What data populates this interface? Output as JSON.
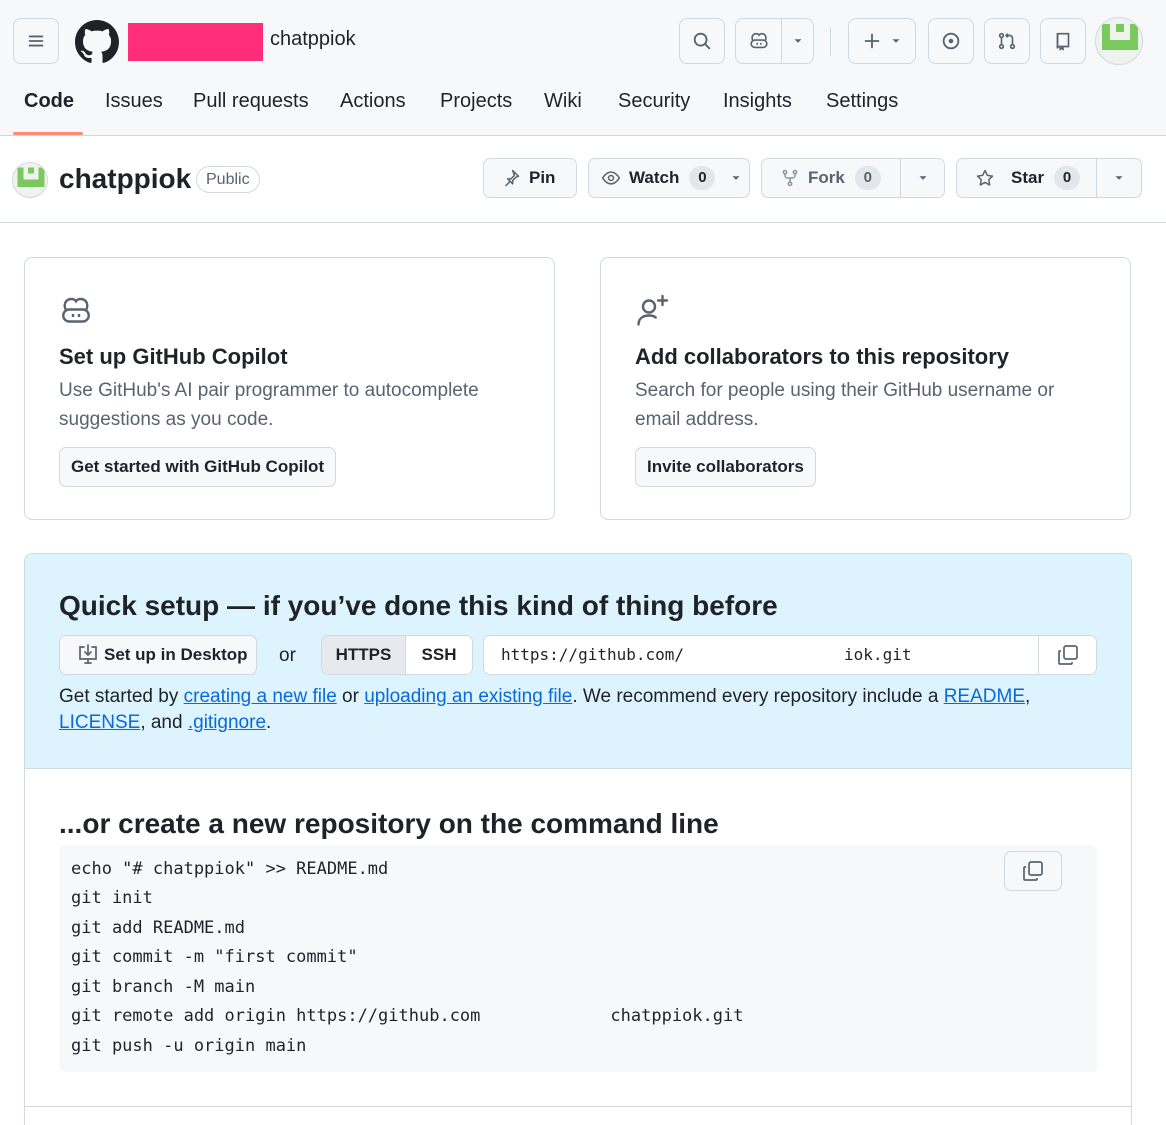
{
  "header": {
    "repo_name": "chatppiok",
    "owner_redact_color": "#ff2d7a",
    "icons": [
      "menu-icon",
      "github-logo",
      "search-icon",
      "copilot-icon",
      "chevron-down-icon",
      "plus-icon",
      "issues-icon",
      "pull-request-icon",
      "inbox-icon"
    ]
  },
  "nav": {
    "tabs": [
      {
        "label": "Code",
        "active": true
      },
      {
        "label": "Issues"
      },
      {
        "label": "Pull requests"
      },
      {
        "label": "Actions"
      },
      {
        "label": "Projects"
      },
      {
        "label": "Wiki"
      },
      {
        "label": "Security"
      },
      {
        "label": "Insights"
      },
      {
        "label": "Settings"
      }
    ],
    "active_underline_color": "#fd8c73"
  },
  "repo": {
    "title": "chatppiok",
    "visibility": "Public",
    "pin_label": "Pin",
    "watch_label": "Watch",
    "watch_count": "0",
    "fork_label": "Fork",
    "fork_count": "0",
    "star_label": "Star",
    "star_count": "0"
  },
  "cards": {
    "copilot": {
      "title": "Set up GitHub Copilot",
      "description": "Use GitHub's AI pair programmer to autocomplete suggestions as you code.",
      "button": "Get started with GitHub Copilot"
    },
    "collaborators": {
      "title": "Add collaborators to this repository",
      "description": "Search for people using their GitHub username or email address.",
      "button": "Invite collaborators"
    }
  },
  "quick_setup": {
    "title": "Quick setup — if you’ve done this kind of thing before",
    "desktop_button": "Set up in Desktop",
    "or": "or",
    "https_tab": "HTTPS",
    "ssh_tab": "SSH",
    "url_prefix": "https://github.com/",
    "url_suffix": "iok.git",
    "help": {
      "t1": "Get started by ",
      "link1": "creating a new file",
      "t2": " or ",
      "link2": "uploading an existing file",
      "t3": ". We recommend every repository include a ",
      "link3": "README",
      "t4": ", ",
      "link4": "LICENSE",
      "t5": ", and ",
      "link5": ".gitignore",
      "t6": "."
    },
    "link_color": "#0969da",
    "background_color": "#ddf4ff"
  },
  "cli": {
    "title": "...or create a new repository on the command line",
    "lines": [
      "echo \"# chatppiok\" >> README.md",
      "git init",
      "git add README.md",
      "git commit -m \"first commit\"",
      "git branch -M main",
      "git remote add origin https://github.com",
      "git push -u origin main"
    ],
    "remote_suffix": "chatppiok.git"
  }
}
